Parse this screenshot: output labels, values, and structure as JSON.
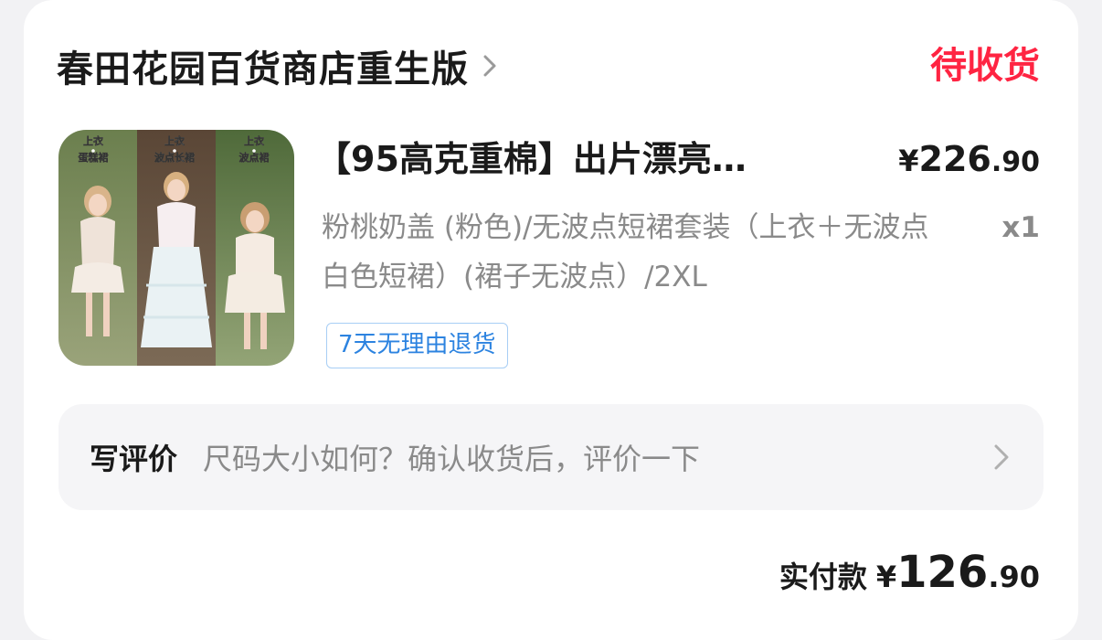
{
  "shop": {
    "name": "春田花园百货商店重生版",
    "chevron_icon": "chevron-right-icon"
  },
  "order": {
    "status": "待收货"
  },
  "product": {
    "thumbnail_labels": [
      {
        "top": "上衣",
        "bottom": "蛋糕裙"
      },
      {
        "top": "上衣",
        "bottom": "波点长裙"
      },
      {
        "top": "上衣",
        "bottom": "波点裙"
      }
    ],
    "title": "【95高克重棉】出片漂亮…",
    "price": {
      "symbol": "¥",
      "integer": "226",
      "decimal": ".90"
    },
    "spec": "粉桃奶盖 (粉色)/无波点短裙套装（上衣＋无波点白色短裙）(裙子无波点）/2XL",
    "quantity": "x1",
    "return_tag": "7天无理由退货"
  },
  "review": {
    "label": "写评价",
    "prompt": "尺码大小如何？确认收货后，评价一下",
    "chevron_icon": "chevron-right-icon"
  },
  "payment": {
    "label": "实付款",
    "symbol": "¥",
    "integer": "126",
    "decimal": ".90"
  },
  "colors": {
    "status": "#ff2442",
    "tag_blue": "#2c83e0",
    "text_primary": "#1a1a1a",
    "text_secondary": "#8a8a8a"
  }
}
